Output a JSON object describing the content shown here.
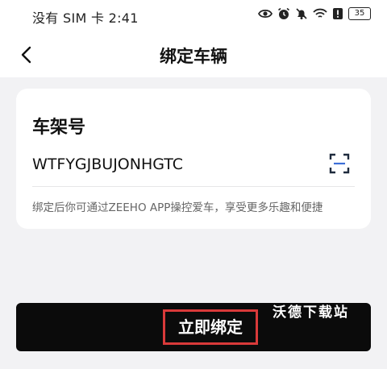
{
  "status_bar": {
    "carrier_time": "没有 SIM 卡 2:41",
    "battery": "35",
    "icons": [
      "eye-icon",
      "alarm-icon",
      "bell-off-icon",
      "wifi-icon",
      "alert-icon",
      "battery-icon"
    ]
  },
  "nav": {
    "back_icon": "chevron-left-icon",
    "title": "绑定车辆"
  },
  "form": {
    "label": "车架号",
    "vin_value": "WTFYGJBUJONHGTC",
    "scan_icon": "scan-icon",
    "hint": "绑定后你可通过ZEEHO APP操控爱车，享受更多乐趣和便捷"
  },
  "action": {
    "bind_label": "立即绑定",
    "highlight_color": "#d93a3a"
  },
  "watermark": "沃德下载站"
}
